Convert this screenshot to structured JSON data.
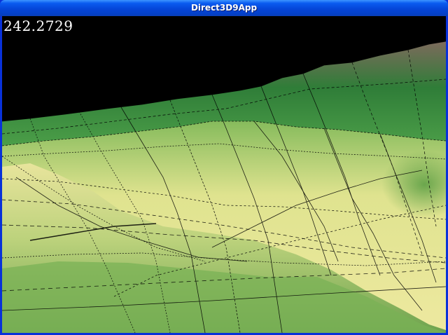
{
  "window": {
    "title": "Direct3D9App"
  },
  "hud": {
    "fps_readout": "242.2729"
  },
  "scene": {
    "sky_color": "#000000",
    "terrain_colors": [
      "#7d6a5c",
      "#2f8a3c",
      "#5aa84e",
      "#e6e696",
      "#f2f0a0",
      "#7fb55a",
      "#6ea34e"
    ],
    "wireframe_color": "#000000"
  }
}
